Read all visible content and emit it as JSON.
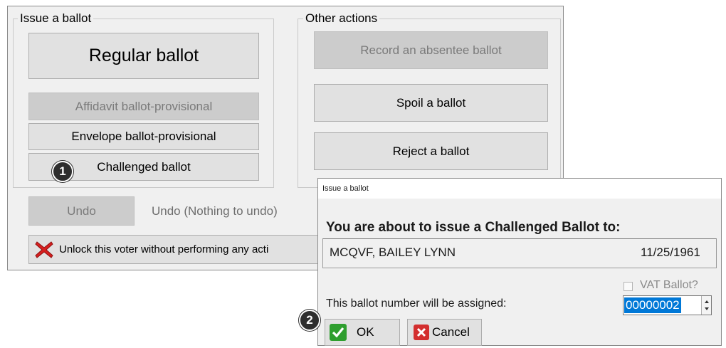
{
  "main_window": {
    "issue_group": {
      "legend": "Issue a ballot",
      "regular_ballot": "Regular ballot",
      "affidavit_ballot": "Affidavit ballot-provisional",
      "envelope_ballot": "Envelope ballot-provisional",
      "challenged_ballot": "Challenged ballot"
    },
    "other_group": {
      "legend": "Other actions",
      "record_absentee": "Record an absentee ballot",
      "spoil_ballot": "Spoil a ballot",
      "reject_ballot": "Reject a ballot"
    },
    "undo_button": "Undo",
    "undo_status": "Undo (Nothing to undo)",
    "unlock_label": "Unlock this voter without performing any acti"
  },
  "dialog": {
    "title": "Issue a ballot",
    "heading": "You are about to issue a Challenged Ballot to:",
    "voter_name": "MCQVF, BAILEY LYNN",
    "voter_dob": "11/25/1961",
    "vat_label": "VAT Ballot?",
    "ballot_number_label": "This ballot number will be assigned:",
    "ballot_number": "00000002",
    "ok_label": "OK",
    "cancel_label": "Cancel"
  },
  "markers": {
    "step1": "1",
    "step2": "2"
  },
  "icons": {
    "unlock": "red-x-icon",
    "ok": "green-check-icon",
    "cancel": "red-x-box-icon",
    "stepper": "stepper-arrows-icon"
  },
  "colors": {
    "selection": "#0078d7",
    "ok_green": "#2e9e2e",
    "cancel_red": "#d32f2f"
  }
}
